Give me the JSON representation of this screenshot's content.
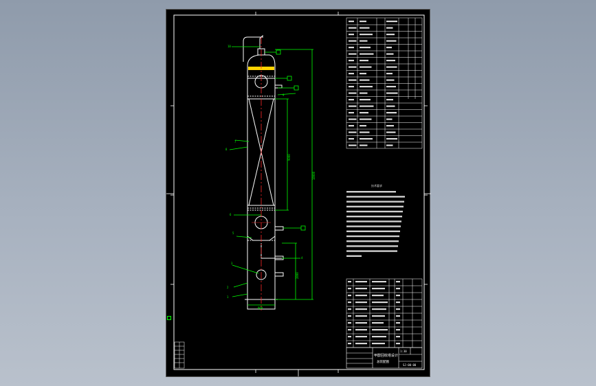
{
  "drawing": {
    "title": "甲醇回收塔设计",
    "subtitle": "总装配图",
    "drawing_no": "SJ-00-00",
    "scale": "1:30",
    "colors": {
      "background_gradient_top": "#8f9bab",
      "background_gradient_bottom": "#b9c1cc",
      "sheet": "#000000",
      "frame": "#ffffff",
      "equipment": "#ffffff",
      "leader": "#00ff00",
      "centerline": "#ff2a2a",
      "packing_top": "#ffd400",
      "insertion_marker": "#00ff00"
    }
  },
  "callouts": [
    "10",
    "9",
    "8",
    "7",
    "6",
    "5",
    "4",
    "3",
    "2",
    "1"
  ],
  "dimensions": {
    "total_height": "18000",
    "section_height": "9000",
    "bottom_section": "2800",
    "diameter": "800"
  },
  "notes_title": "技术要求"
}
